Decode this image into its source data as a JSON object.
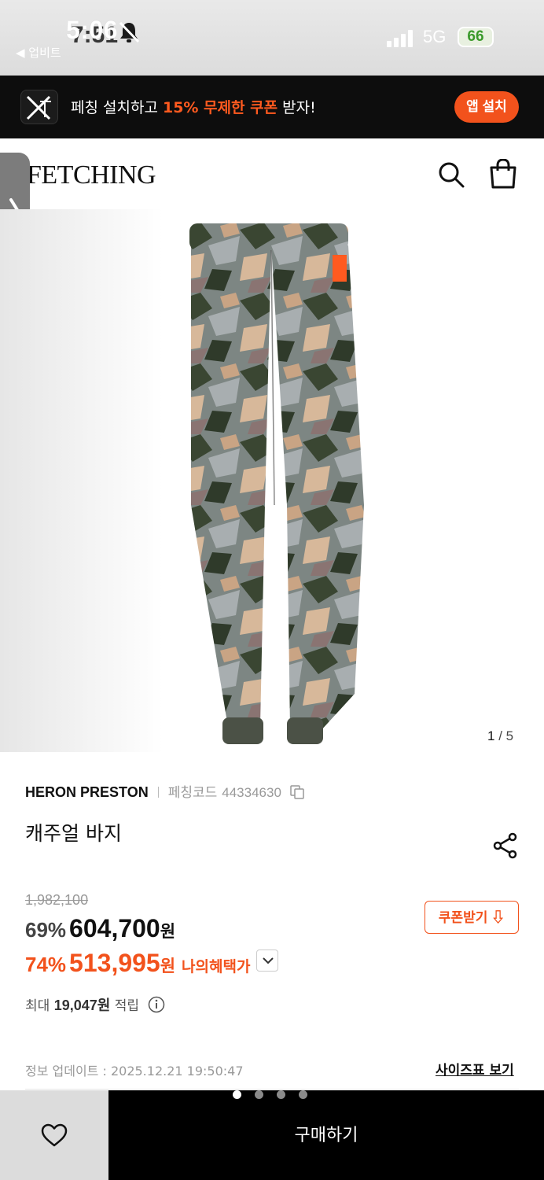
{
  "status_bar": {
    "time": "5:06",
    "time_underlay": "7:51",
    "back_app": "◀ 업비트",
    "network": "5G",
    "battery": "66"
  },
  "promo": {
    "text_prefix": "페칭 설치하고 ",
    "text_highlight": "15% 무제한 쿠폰",
    "text_suffix": " 받자!",
    "install_label": "앱 설치"
  },
  "header": {
    "brand": "FETCHING",
    "icons": [
      "search-icon",
      "shopping-bag-icon"
    ]
  },
  "gallery": {
    "current": "1",
    "total": "/ 5"
  },
  "product": {
    "brand": "HERON PRESTON",
    "code_label": "페칭코드",
    "code": "44334630",
    "name": "캐주얼 바지",
    "original_price": "1,982,100",
    "discount_pct": "69%",
    "price": "604,700",
    "currency": "원",
    "benefit_pct": "74%",
    "benefit_price": "513,995",
    "benefit_label": "나의혜택가",
    "coupon_label": "쿠폰받기 ⇩",
    "points_prefix": "최대 ",
    "points_value": "19,047원",
    "points_suffix": " 적립",
    "updated": "정보 업데이트 : 2025.12.21 19:50:47",
    "size_chart": "사이즈표 보기"
  },
  "bottom_bar": {
    "buy_label": "구매하기"
  },
  "colors": {
    "accent": "#f2521c",
    "banner_bg": "#0d0d0d",
    "bottom_bar_bg": "#000000"
  }
}
